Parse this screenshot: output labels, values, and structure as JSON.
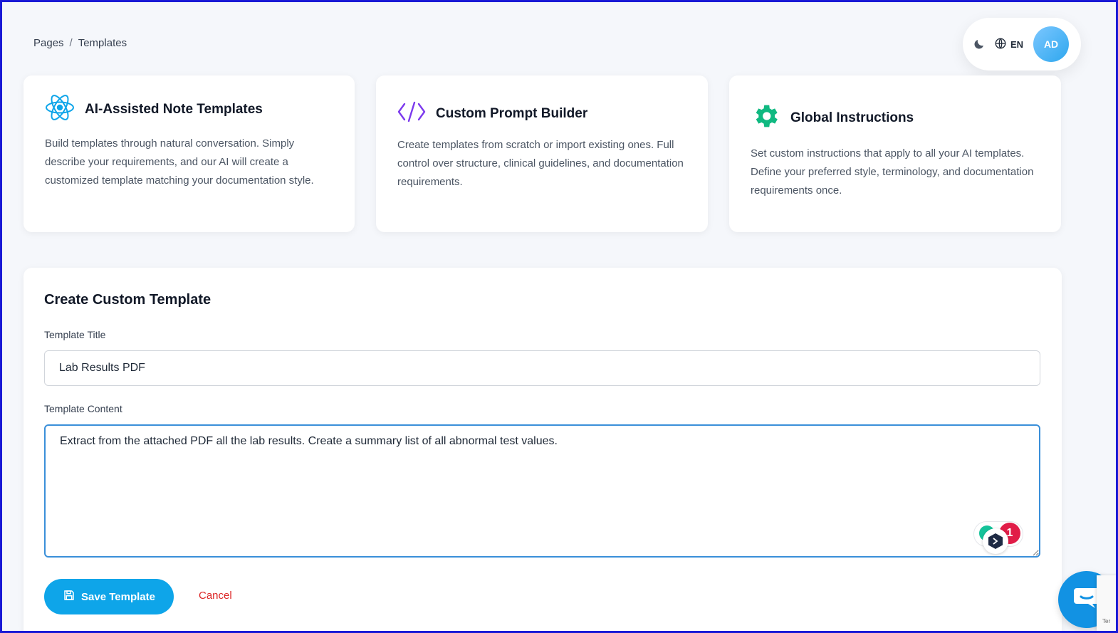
{
  "breadcrumb": {
    "items": [
      "Pages",
      "Templates"
    ],
    "separator": "/"
  },
  "topbar": {
    "language": "EN",
    "avatar_initials": "AD",
    "theme_icon": "moon-icon",
    "language_icon": "globe-icon"
  },
  "cards": [
    {
      "icon": "react-atom-icon",
      "icon_color": "#0ea5e9",
      "title": "AI-Assisted Note Templates",
      "description": "Build templates through natural conversation. Simply describe your requirements, and our AI will create a customized template matching your documentation style."
    },
    {
      "icon": "code-icon",
      "icon_color": "#7c3aed",
      "title": "Custom Prompt Builder",
      "description": "Create templates from scratch or import existing ones. Full control over structure, clinical guidelines, and documentation requirements."
    },
    {
      "icon": "gear-icon",
      "icon_color": "#10b981",
      "title": "Global Instructions",
      "description": "Set custom instructions that apply to all your AI templates. Define your preferred style, terminology, and documentation requirements once."
    }
  ],
  "form": {
    "heading": "Create Custom Template",
    "title_label": "Template Title",
    "title_value": "Lab Results PDF",
    "content_label": "Template Content",
    "content_value": "Extract from the attached PDF all the lab results. Create a summary list of all abnormal test values.",
    "save_label": "Save Template",
    "cancel_label": "Cancel"
  },
  "overlays": {
    "grammar_count": "1",
    "recaptcha_text": "Ter"
  },
  "colors": {
    "primary": "#0ea5e9",
    "danger": "#dc2626",
    "focus_border": "#3a8fd9",
    "chat_button": "#1292e3"
  }
}
